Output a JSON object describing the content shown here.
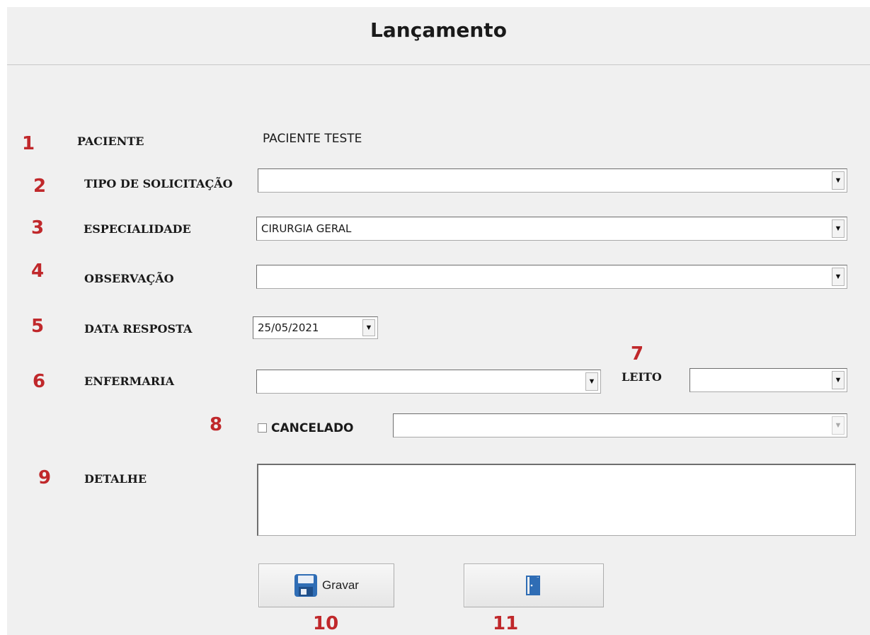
{
  "window": {
    "title": "Lançamento"
  },
  "markers": [
    "1",
    "2",
    "3",
    "4",
    "5",
    "6",
    "7",
    "8",
    "9",
    "10",
    "11"
  ],
  "fields": {
    "paciente": {
      "label": "PACIENTE",
      "value": "PACIENTE TESTE"
    },
    "tipo_solicitacao": {
      "label": "TIPO DE SOLICITAÇÃO",
      "value": ""
    },
    "especialidade": {
      "label": "ESPECIALIDADE",
      "value": "CIRURGIA GERAL"
    },
    "observacao": {
      "label": "OBSERVAÇÃO",
      "value": ""
    },
    "data_resposta": {
      "label": "DATA RESPOSTA",
      "value": "25/05/2021"
    },
    "enfermaria": {
      "label": "ENFERMARIA",
      "value": ""
    },
    "leito": {
      "label": "LEITO",
      "value": ""
    },
    "cancelado": {
      "label": "CANCELADO",
      "checked": false,
      "reason": ""
    },
    "detalhe": {
      "label": "DETALHE",
      "value": ""
    }
  },
  "buttons": {
    "gravar": {
      "label": "Gravar",
      "icon": "floppy-disk-icon"
    },
    "sair": {
      "icon": "door-exit-icon"
    }
  },
  "colors": {
    "marker": "#c0282b",
    "icon_blue": "#2f6db5"
  }
}
